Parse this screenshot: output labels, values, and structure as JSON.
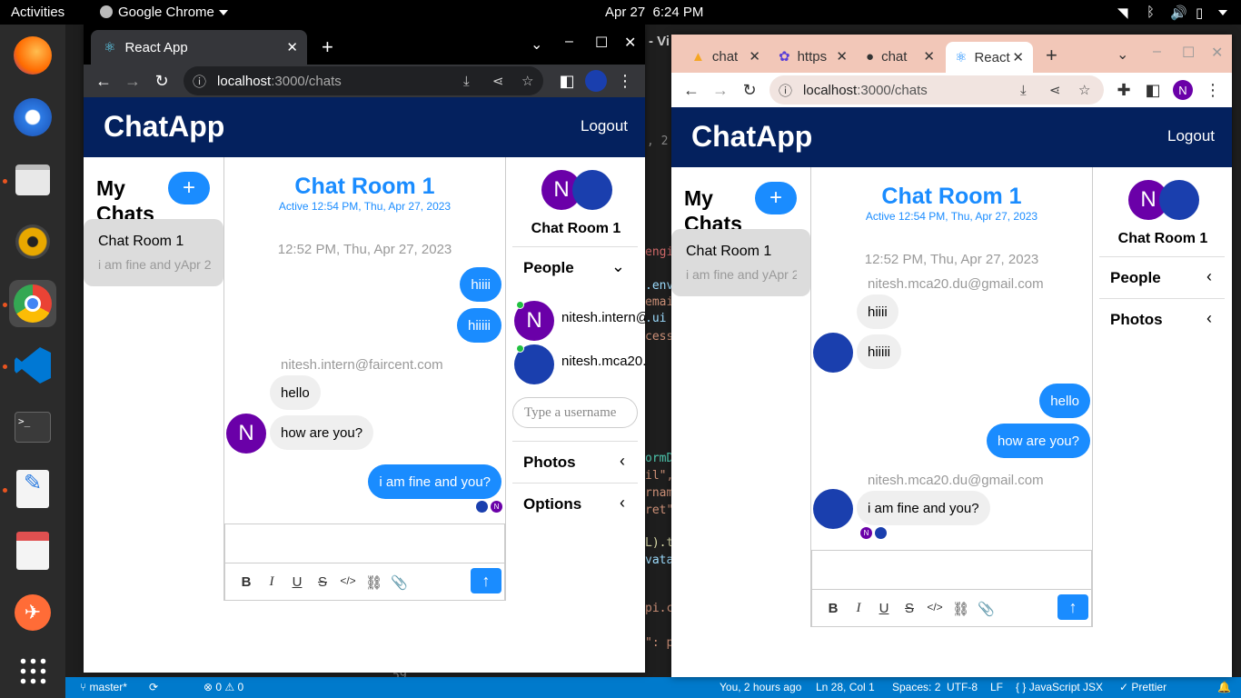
{
  "topbar": {
    "activities": "Activities",
    "app_name": "Google Chrome",
    "date": "Apr 27",
    "time": "6:24 PM"
  },
  "dock": {
    "apps": [
      "firefox-icon",
      "thunderbird-icon",
      "files-icon",
      "rhythmbox-icon",
      "chrome-icon",
      "vscode-icon",
      "terminal-icon",
      "text-editor-icon",
      "document-viewer-icon",
      "postman-icon",
      "app-grid-icon"
    ]
  },
  "vscode": {
    "branch": "master*",
    "errors": "0",
    "warnings": "0",
    "blame": "You, 2 hours ago",
    "position": "Ln 28, Col 1",
    "spaces": "Spaces: 2",
    "encoding": "UTF-8",
    "eol": "LF",
    "language": "JavaScript JSX",
    "formatter": "Prettier",
    "title_fragment": "- Vi",
    "code_fragments": [
      ", 2",
      "engi",
      ".env",
      "emai",
      ".ui",
      "cess",
      "ormD",
      "il\",",
      "rnam",
      "ret\"",
      "L).t",
      "vata",
      "pi.c",
      "\": p",
      "59"
    ]
  },
  "left_window": {
    "tab_title": "React App",
    "url_host": "localhost",
    "url_path": ":3000/chats",
    "app": {
      "title": "ChatApp",
      "logout": "Logout",
      "my_chats": "My Chats",
      "add_button": "+",
      "chat_card": {
        "name": "Chat Room 1",
        "preview": "i am fine and yApr 2"
      },
      "room_title": "Chat Room 1",
      "room_active": "Active 12:54 PM, Thu, Apr 27, 2023",
      "timestamp": "12:52 PM, Thu, Apr 27, 2023",
      "messages": [
        {
          "text": "hiiii"
        },
        {
          "text": "hiiiii"
        },
        {
          "sender": "nitesh.intern@faircent.com"
        },
        {
          "text": "hello"
        },
        {
          "text": "how are you?"
        },
        {
          "text": "i am fine and you?"
        }
      ],
      "right_title": "Chat Room 1",
      "people_label": "People",
      "people": [
        "nitesh.intern@",
        "nitesh.mca20."
      ],
      "username_placeholder": "Type a username",
      "photos_label": "Photos",
      "options_label": "Options",
      "avatar_letter": "N"
    }
  },
  "right_window": {
    "tabs": [
      "chat",
      "https",
      "chat",
      "React"
    ],
    "url_host": "localhost",
    "url_path": ":3000/chats",
    "profile_letter": "N",
    "app": {
      "title": "ChatApp",
      "logout": "Logout",
      "my_chats": "My Chats",
      "add_button": "+",
      "chat_card": {
        "name": "Chat Room 1",
        "preview": "i am fine and yApr 2"
      },
      "room_title": "Chat Room 1",
      "room_active": "Active 12:54 PM, Thu, Apr 27, 2023",
      "timestamp": "12:52 PM, Thu, Apr 27, 2023",
      "sender1": "nitesh.mca20.du@gmail.com",
      "msg1": "hiiii",
      "msg2": "hiiiii",
      "msg3": "hello",
      "msg4": "how are you?",
      "sender2": "nitesh.mca20.du@gmail.com",
      "msg5": "i am fine and you?",
      "right_title": "Chat Room 1",
      "people_label": "People",
      "photos_label": "Photos",
      "avatar_letter": "N"
    }
  },
  "colors": {
    "header": "#04215e",
    "accent": "#1a8cff",
    "avatar": "#6a00a8",
    "vscode_status": "#007acc"
  }
}
